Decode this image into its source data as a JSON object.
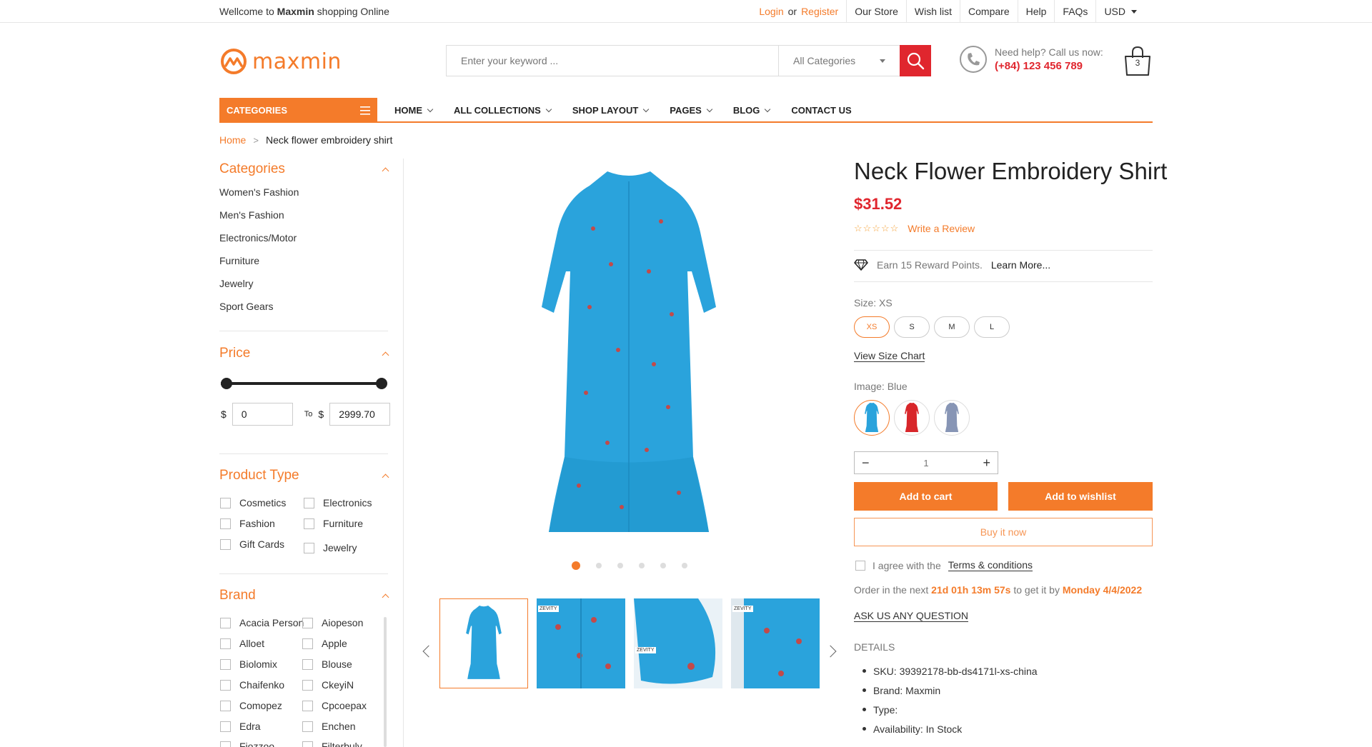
{
  "topbar": {
    "welcome_prefix": "Wellcome to ",
    "welcome_brand": "Maxmin",
    "welcome_suffix": " shopping Online",
    "login": "Login",
    "or": "or",
    "register": "Register",
    "links": [
      "Our Store",
      "Wish list",
      "Compare",
      "Help",
      "FAQs"
    ],
    "currency": "USD"
  },
  "header": {
    "logo_text": "maxmin",
    "search_placeholder": "Enter your keyword ...",
    "search_category": "All Categories",
    "help_label": "Need help? Call us now:",
    "help_phone": "(+84) 123 456 789",
    "cart_count": "3"
  },
  "nav": {
    "categories": "CATEGORIES",
    "items": [
      "HOME",
      "ALL COLLECTIONS",
      "SHOP LAYOUT",
      "PAGES",
      "BLOG",
      "CONTACT US"
    ]
  },
  "breadcrumb": {
    "home": "Home",
    "current": "Neck flower embroidery shirt"
  },
  "sidebar": {
    "categories_title": "Categories",
    "categories": [
      "Women's Fashion",
      "Men's Fashion",
      "Electronics/Motor",
      "Furniture",
      "Jewelry",
      "Sport Gears"
    ],
    "price_title": "Price",
    "currency_symbol": "$",
    "price_min": "0",
    "price_to": "To",
    "price_max": "2999.70",
    "product_type_title": "Product Type",
    "product_types": [
      "Cosmetics",
      "Electronics",
      "Fashion",
      "Furniture",
      "Gift Cards",
      "Jewelry"
    ],
    "brand_title": "Brand",
    "brands": [
      "Acacia Person",
      "Aiopeson",
      "Alloet",
      "Apple",
      "Biolomix",
      "Blouse",
      "Chaifenko",
      "CkeyiN",
      "Comopez",
      "Cpcoepax",
      "Edra",
      "Enchen",
      "Fiozzoo",
      "Filterbuly"
    ]
  },
  "product": {
    "title": "Neck Flower Embroidery Shirt",
    "price": "$31.52",
    "rating": 0,
    "write_review": "Write a Review",
    "reward_text": "Earn 15 Reward Points.",
    "learn_more": "Learn More...",
    "size_label": "Size: XS",
    "sizes": [
      "XS",
      "S",
      "M",
      "L"
    ],
    "selected_size": "XS",
    "size_chart": "View Size Chart",
    "image_label": "Image: Blue",
    "swatch_colors": [
      "#2aa3dc",
      "#d8262a",
      "#8795b5"
    ],
    "quantity": "1",
    "add_to_cart": "Add to cart",
    "add_to_wishlist": "Add to wishlist",
    "buy_now": "Buy it now",
    "agree_text": "I agree with the",
    "terms": "Terms & conditions",
    "order_prefix": "Order in the next",
    "order_countdown": "21d 01h 13m 57s",
    "order_middle": "to get it by",
    "order_date": "Monday 4/4/2022",
    "ask": "ASK US ANY QUESTION",
    "details_title": "DETAILS",
    "details": [
      "SKU: 39392178-bb-ds4171l-xs-china",
      "Brand: Maxmin",
      "Type:",
      "Availability: In Stock"
    ],
    "gallery_active_index": 0,
    "gallery_dot_count": 6,
    "thumb_label": "ZEVITY"
  },
  "colors": {
    "accent": "#f47b2a",
    "red": "#e0262e",
    "dress": "#2aa3dc"
  }
}
